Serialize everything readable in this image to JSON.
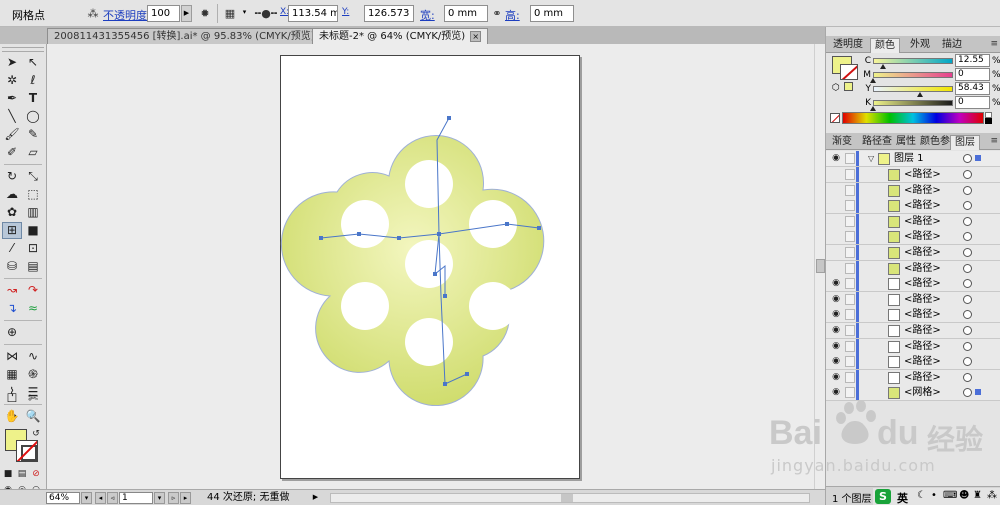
{
  "control_bar": {
    "tool_name": "网格点",
    "opacity_label": "不透明度:",
    "opacity_value": "100",
    "opacity_unit": "%",
    "x_label": "X:",
    "x_value": "113.54 mm",
    "y_label": "Y:",
    "y_value": "126.573 mm",
    "w_label": "宽:",
    "w_value": "0 mm",
    "h_label": "高:",
    "h_value": "0 mm"
  },
  "document_tabs": [
    {
      "title": "200811431355456 [转换].ai* @ 95.83% (CMYK/预览)",
      "close": "×",
      "active": false
    },
    {
      "title": "未标题-2* @ 64% (CMYK/预览)",
      "close": "×",
      "active": true
    }
  ],
  "tools": {
    "selected": "mesh-tool",
    "fill_color": "#eef28a",
    "icons": [
      "selection-icon",
      "direct-selection-icon",
      "magic-wand-icon",
      "lasso-icon",
      "pen-icon",
      "type-icon",
      "line-segment-icon",
      "ellipse-icon",
      "paintbrush-icon",
      "pencil-icon",
      "blob-brush-icon",
      "eraser-icon",
      "rotate-icon",
      "scale-icon",
      "warp-icon",
      "free-transform-icon",
      "symbol-sprayer-icon",
      "column-graph-icon",
      "mesh-icon",
      "gradient-icon",
      "eyedropper-icon",
      "blend-icon",
      "live-paint-bucket-icon",
      "live-paint-selection-icon",
      "artboard-icon",
      "slice-icon",
      "hand-icon",
      "zoom-icon"
    ]
  },
  "status_bar": {
    "zoom": "64%",
    "page": "1",
    "info": "44 次还原; 无重做"
  },
  "color_panel": {
    "tabs": [
      "透明度",
      "颜色",
      "外观",
      "描边"
    ],
    "active_tab": "颜色",
    "fill_color": "#eef28a",
    "channels": [
      {
        "name": "C",
        "value": "12.55",
        "unit": "%",
        "fraction": 0.1255,
        "grad_from": "#f8f59a",
        "grad_to": "#00a6c8"
      },
      {
        "name": "M",
        "value": "0",
        "unit": "%",
        "fraction": 0.0,
        "grad_from": "#eef28a",
        "grad_to": "#e5408e"
      },
      {
        "name": "Y",
        "value": "58.43",
        "unit": "%",
        "fraction": 0.5843,
        "grad_from": "#e9f2ff",
        "grad_to": "#f2e600"
      },
      {
        "name": "K",
        "value": "0",
        "unit": "%",
        "fraction": 0.0,
        "grad_from": "#eef28a",
        "grad_to": "#1a1a1a"
      }
    ]
  },
  "layers_panel": {
    "tabs": [
      "渐变",
      "路径查",
      "属性",
      "颜色参",
      "图层"
    ],
    "active_tab": "图层",
    "layer_name": "图层 1",
    "items": [
      {
        "name": "<路径>",
        "visible": false,
        "swatch": "#d9e57a"
      },
      {
        "name": "<路径>",
        "visible": false,
        "swatch": "#d9e57a"
      },
      {
        "name": "<路径>",
        "visible": false,
        "swatch": "#d9e57a"
      },
      {
        "name": "<路径>",
        "visible": false,
        "swatch": "#d9e57a"
      },
      {
        "name": "<路径>",
        "visible": false,
        "swatch": "#d9e57a"
      },
      {
        "name": "<路径>",
        "visible": false,
        "swatch": "#d9e57a"
      },
      {
        "name": "<路径>",
        "visible": false,
        "swatch": "#d9e57a"
      },
      {
        "name": "<路径>",
        "visible": true,
        "swatch": "#ffffff"
      },
      {
        "name": "<路径>",
        "visible": true,
        "swatch": "#ffffff"
      },
      {
        "name": "<路径>",
        "visible": true,
        "swatch": "#ffffff"
      },
      {
        "name": "<路径>",
        "visible": true,
        "swatch": "#ffffff"
      },
      {
        "name": "<路径>",
        "visible": true,
        "swatch": "#ffffff"
      },
      {
        "name": "<路径>",
        "visible": true,
        "swatch": "#ffffff"
      },
      {
        "name": "<路径>",
        "visible": true,
        "swatch": "#ffffff"
      },
      {
        "name": "<网格>",
        "visible": true,
        "swatch": "#d9e57a"
      }
    ],
    "footer": "1 个图层"
  },
  "watermark": {
    "brand": "Bai",
    "brand2": "du",
    "cn": "经验",
    "url": "jingyan.baidu.com"
  },
  "taskbar": {
    "ime": "英"
  },
  "colors": {
    "ui_bg": "#e4e4e4",
    "canvas_bg": "#ececec",
    "shape_light": "#f1f5b5",
    "shape_dark": "#cfdd6c",
    "mesh_line": "#4a76c9",
    "link": "#1d3ebf"
  }
}
